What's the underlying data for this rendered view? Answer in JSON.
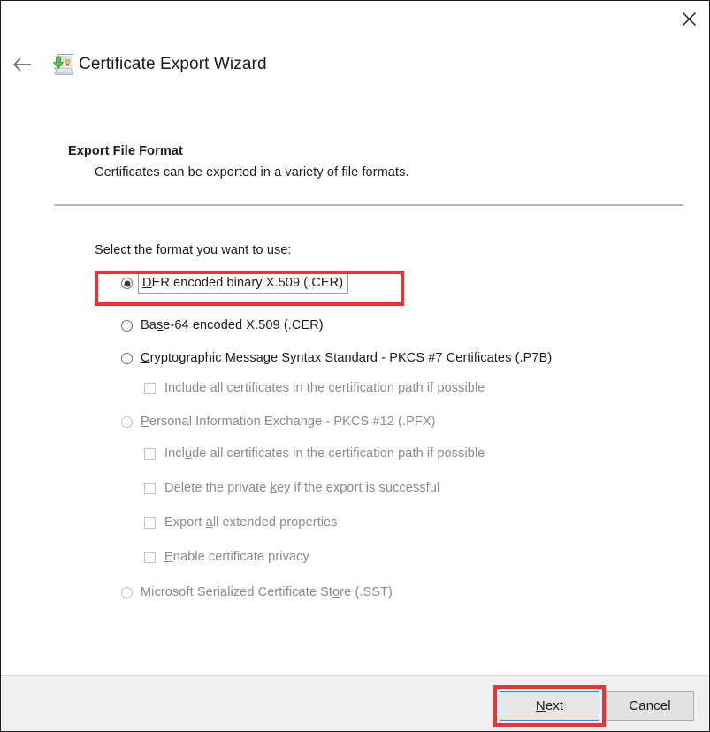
{
  "window": {
    "title": "Certificate Export Wizard",
    "close_label": "×",
    "back_label": "←",
    "icon": "certificate-export-icon"
  },
  "section": {
    "title": "Export File Format",
    "subtitle": "Certificates can be exported in a variety of file formats."
  },
  "body": {
    "intro": "Select the format you want to use:",
    "options": [
      {
        "id": "der",
        "type": "radio",
        "label": "DER encoded binary X.509 (.CER)",
        "accel_before": "",
        "accel": "D",
        "accel_after": "ER encoded binary X.509 (.CER)",
        "checked": true,
        "disabled": false,
        "focused": true,
        "indent": 0,
        "highlighted": true
      },
      {
        "id": "base64",
        "type": "radio",
        "label": "Base-64 encoded X.509 (.CER)",
        "accel_before": "Ba",
        "accel": "s",
        "accel_after": "e-64 encoded X.509 (.CER)",
        "checked": false,
        "disabled": false,
        "focused": false,
        "indent": 0,
        "highlighted": false
      },
      {
        "id": "pkcs7",
        "type": "radio",
        "label": "Cryptographic Message Syntax Standard - PKCS #7 Certificates (.P7B)",
        "accel_before": "",
        "accel": "C",
        "accel_after": "ryptographic Message Syntax Standard - PKCS #7 Certificates (.P7B)",
        "checked": false,
        "disabled": false,
        "focused": false,
        "indent": 0,
        "highlighted": false
      },
      {
        "id": "pkcs7-include-path",
        "type": "checkbox",
        "label": "Include all certificates in the certification path if possible",
        "accel_before": "",
        "accel": "I",
        "accel_after": "nclude all certificates in the certification path if possible",
        "checked": false,
        "disabled": true,
        "focused": false,
        "indent": 1,
        "highlighted": false
      },
      {
        "id": "pfx",
        "type": "radio",
        "label": "Personal Information Exchange - PKCS #12 (.PFX)",
        "accel_before": "",
        "accel": "P",
        "accel_after": "ersonal Information Exchange - PKCS #12 (.PFX)",
        "checked": false,
        "disabled": true,
        "focused": false,
        "indent": 0,
        "highlighted": false
      },
      {
        "id": "pfx-include-path",
        "type": "checkbox",
        "label": "Include all certificates in the certification path if possible",
        "accel_before": "Incl",
        "accel": "u",
        "accel_after": "de all certificates in the certification path if possible",
        "checked": false,
        "disabled": true,
        "focused": false,
        "indent": 1,
        "highlighted": false
      },
      {
        "id": "delete-private-key",
        "type": "checkbox",
        "label": "Delete the private key if the export is successful",
        "accel_before": "Delete the private ",
        "accel": "k",
        "accel_after": "ey if the export is successful",
        "checked": false,
        "disabled": true,
        "focused": false,
        "indent": 1,
        "highlighted": false
      },
      {
        "id": "export-extended-properties",
        "type": "checkbox",
        "label": "Export all extended properties",
        "accel_before": "Export ",
        "accel": "a",
        "accel_after": "ll extended properties",
        "checked": false,
        "disabled": true,
        "focused": false,
        "indent": 1,
        "highlighted": false
      },
      {
        "id": "enable-certificate-privacy",
        "type": "checkbox",
        "label": "Enable certificate privacy",
        "accel_before": "",
        "accel": "E",
        "accel_after": "nable certificate privacy",
        "checked": false,
        "disabled": true,
        "focused": false,
        "indent": 1,
        "highlighted": false
      },
      {
        "id": "sst",
        "type": "radio",
        "label": "Microsoft Serialized Certificate Store (.SST)",
        "accel_before": "Microsoft Serialized Certificate St",
        "accel": "o",
        "accel_after": "re (.SST)",
        "checked": false,
        "disabled": true,
        "focused": false,
        "indent": 0,
        "highlighted": false
      }
    ]
  },
  "footer": {
    "next": {
      "before": "",
      "accel": "N",
      "after": "ext",
      "label": "Next"
    },
    "cancel": {
      "before": "Cancel",
      "accel": "",
      "after": "",
      "label": "Cancel"
    }
  },
  "colors": {
    "annotation_red": "#ec3237",
    "default_button_border": "#2e8ad8",
    "text": "#1a1a1a",
    "disabled_text": "#8a8a8a",
    "footer_bg": "#f0f0f0"
  }
}
